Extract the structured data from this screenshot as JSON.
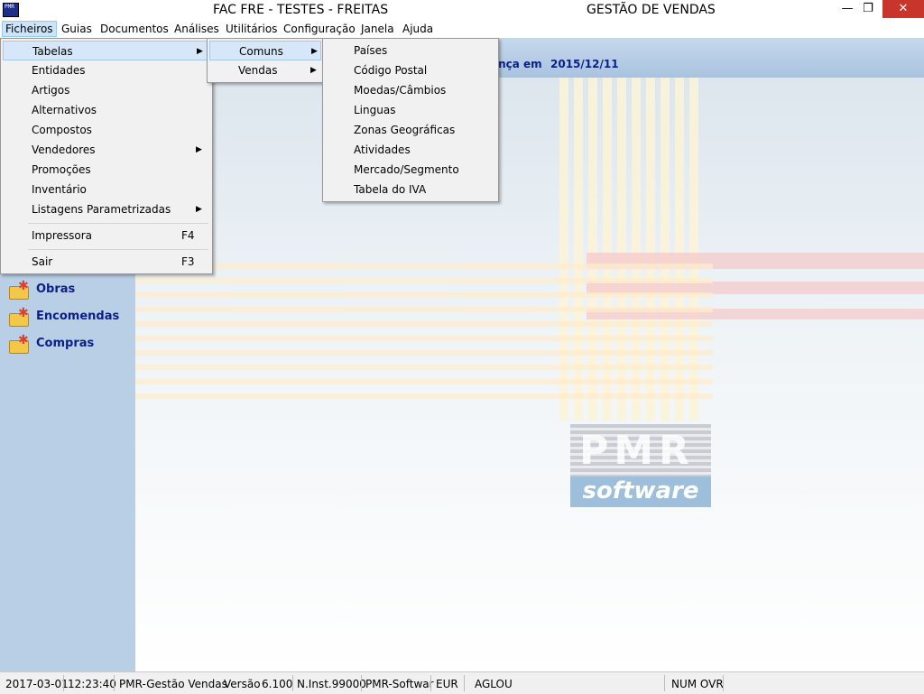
{
  "window": {
    "title_left": "FAC FRE - TESTES - FREITAS",
    "title_right": "GESTÃO DE VENDAS",
    "app_icon_text": "PMR",
    "minimize": "—",
    "maximize": "❐",
    "close": "✕"
  },
  "menubar": {
    "items": [
      "Ficheiros",
      "Guias",
      "Documentos",
      "Análises",
      "Utilitários",
      "Configuração",
      "Janela",
      "Ajuda"
    ]
  },
  "header": {
    "partial_text": "ança em",
    "date": "2015/12/11"
  },
  "sidebar": {
    "items": [
      "Obras",
      "Encomendas",
      "Compras"
    ]
  },
  "menu_ficheiros": {
    "items": [
      {
        "label": "Tabelas",
        "shortcut": "",
        "submenu": true
      },
      {
        "label": "Entidades",
        "shortcut": "",
        "submenu": false
      },
      {
        "label": "Artigos",
        "shortcut": "",
        "submenu": false
      },
      {
        "label": "Alternativos",
        "shortcut": "",
        "submenu": false
      },
      {
        "label": "Compostos",
        "shortcut": "",
        "submenu": false
      },
      {
        "label": "Vendedores",
        "shortcut": "",
        "submenu": true
      },
      {
        "label": "Promoções",
        "shortcut": "",
        "submenu": false
      },
      {
        "label": "Inventário",
        "shortcut": "",
        "submenu": false
      },
      {
        "label": "Listagens Parametrizadas",
        "shortcut": "",
        "submenu": true
      },
      {
        "label": "Impressora",
        "shortcut": "F4",
        "submenu": false
      },
      {
        "label": "Sair",
        "shortcut": "F3",
        "submenu": false
      }
    ]
  },
  "menu_tabelas": {
    "items": [
      "Comuns",
      "Vendas"
    ]
  },
  "menu_comuns": {
    "items": [
      "Países",
      "Código Postal",
      "Moedas/Câmbios",
      "Linguas",
      "Zonas Geográficas",
      "Atividades",
      "Mercado/Segmento",
      "Tabela do IVA"
    ]
  },
  "logo": {
    "top": "PMR",
    "bottom": "software"
  },
  "statusbar": {
    "date": "2017-03-01",
    "time": "12:23:40",
    "app": "PMR-Gestão Vendas",
    "version_label": "Versão",
    "version": "6.100",
    "inst": "N.Inst.99000",
    "company": "PMR-Softwar",
    "currency": "EUR",
    "user": "AGLOU",
    "keys": "NUM OVR"
  },
  "colors": {
    "sidebar_bg": "#b9cfe6",
    "accent_text": "#0b1f8a",
    "menu_hover": "#d5e7f8",
    "close_button": "#c7352b"
  }
}
